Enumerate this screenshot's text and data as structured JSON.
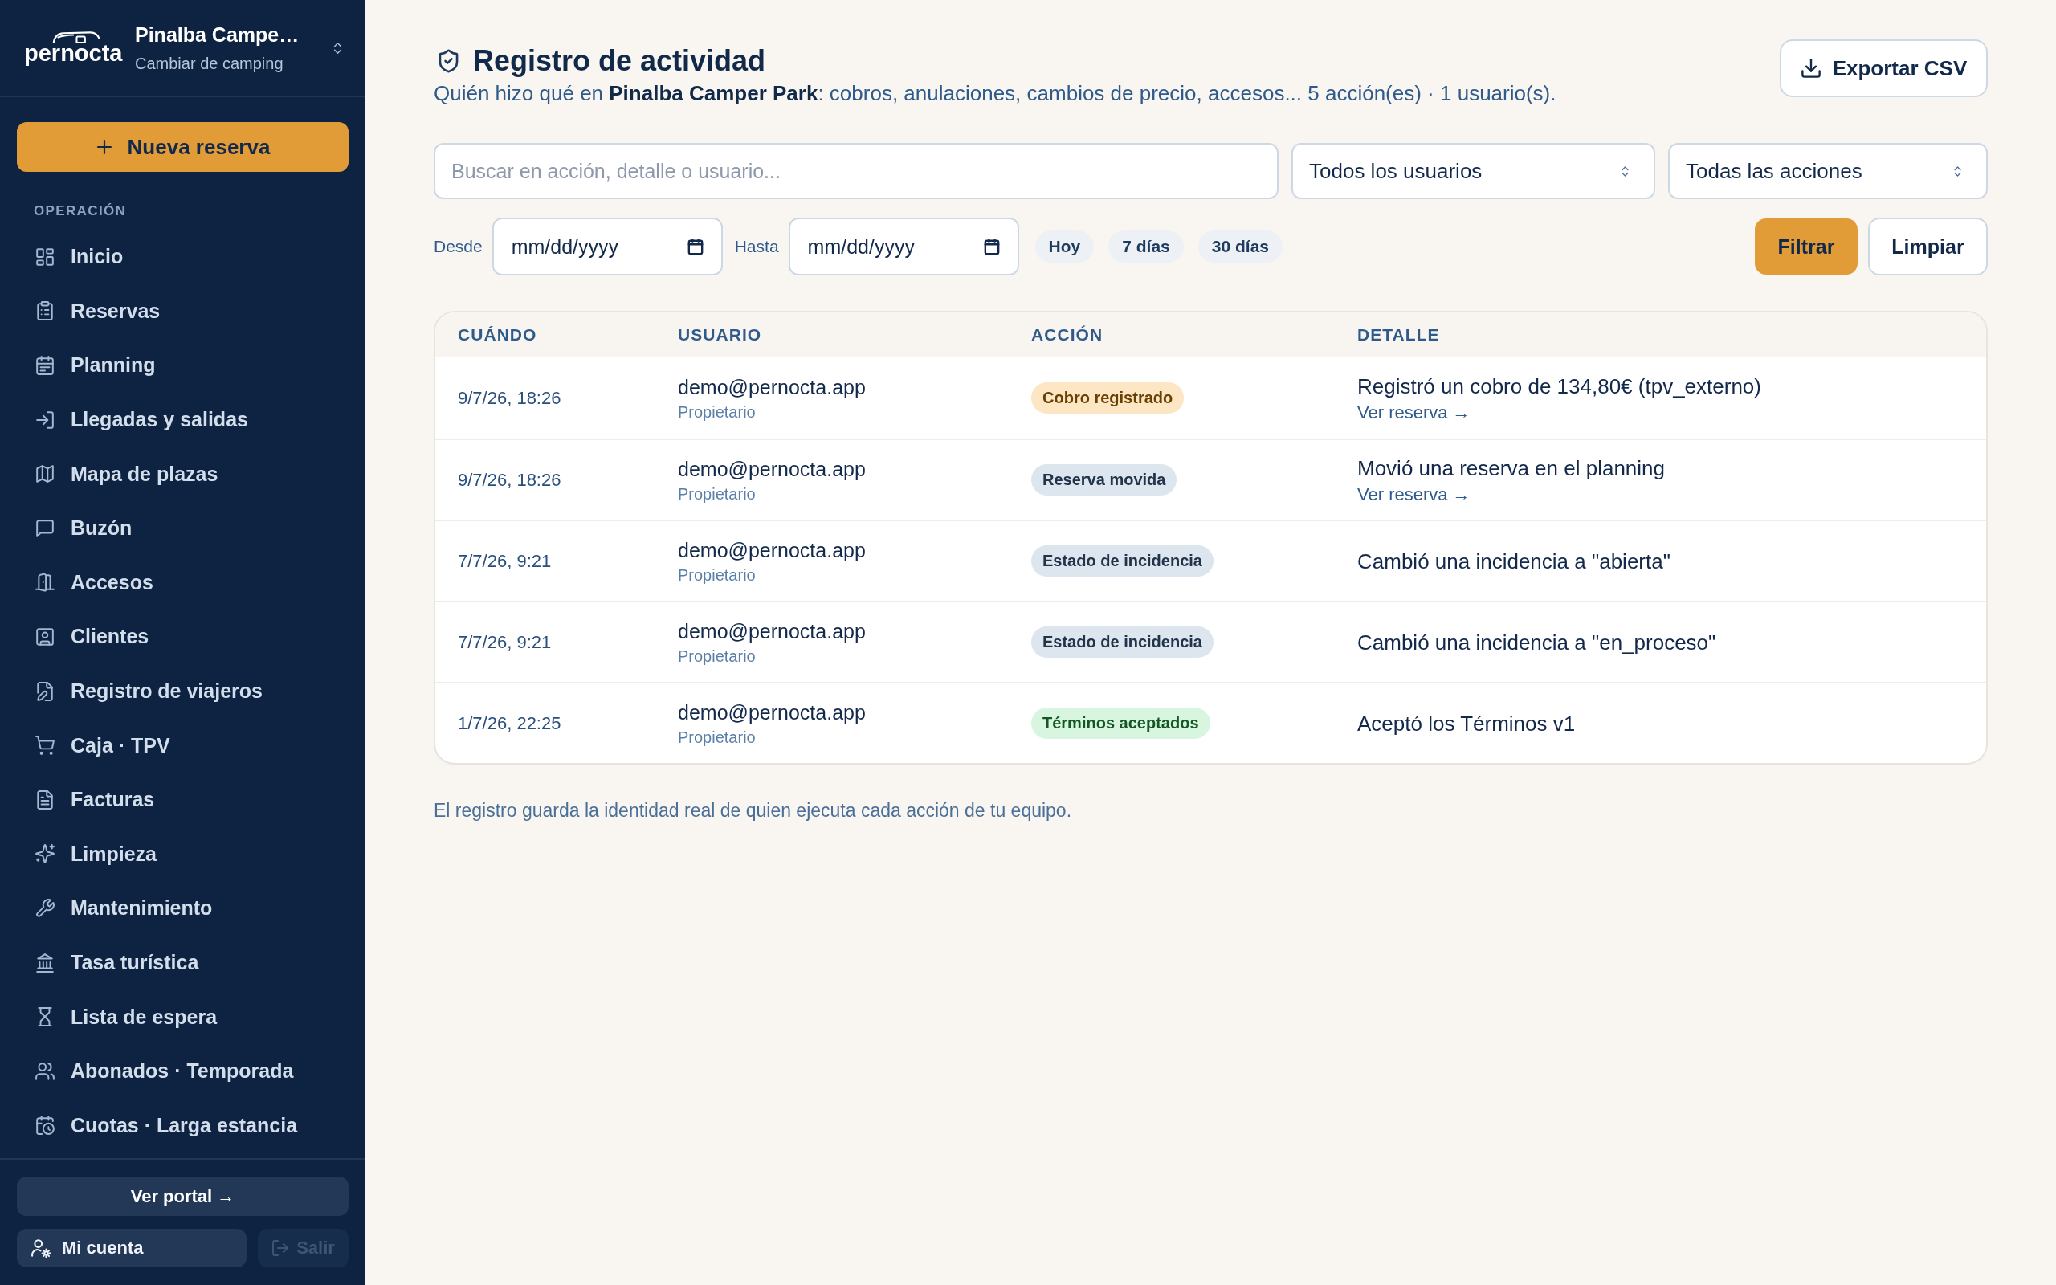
{
  "sidebar": {
    "logo": "pernocta",
    "campsite": {
      "name": "Pinalba Campe…",
      "switch_link": "Cambiar de camping"
    },
    "new_booking_button": "Nueva reserva",
    "section_label": "OPERACIÓN",
    "items": [
      {
        "label": "Inicio",
        "selected": false
      },
      {
        "label": "Reservas",
        "selected": false
      },
      {
        "label": "Planning",
        "selected": false
      },
      {
        "label": "Llegadas y salidas",
        "selected": false
      },
      {
        "label": "Mapa de plazas",
        "selected": false
      },
      {
        "label": "Buzón",
        "selected": false
      },
      {
        "label": "Accesos",
        "selected": false
      },
      {
        "label": "Clientes",
        "selected": false
      },
      {
        "label": "Registro de viajeros",
        "selected": false
      },
      {
        "label": "Caja · TPV",
        "selected": false
      },
      {
        "label": "Facturas",
        "selected": false
      },
      {
        "label": "Limpieza",
        "selected": false
      },
      {
        "label": "Mantenimiento",
        "selected": false
      },
      {
        "label": "Tasa turística",
        "selected": false
      },
      {
        "label": "Lista de espera",
        "selected": false
      },
      {
        "label": "Abonados · Temporada",
        "selected": false
      },
      {
        "label": "Cuotas · Larga estancia",
        "selected": false
      }
    ],
    "footer": {
      "portal_button": "Ver portal →",
      "account_button": "Mi cuenta",
      "logout_button": {
        "label": "Salir",
        "disabled": true
      }
    }
  },
  "header": {
    "title": "Registro de actividad",
    "subtitle": "Quién hizo qué en **Pinalba Camper Park**: cobros, anulaciones, cambios de precio, accesos... 5 acción(es) · 1 usuario(s).",
    "export_button": "Exportar CSV"
  },
  "filters": {
    "search": {
      "placeholder": "Buscar en acción, detalle o usuario..."
    },
    "user_select": {
      "value": "Todos los usuarios"
    },
    "action_select": {
      "value": "Todas las acciones"
    },
    "date_from": {
      "label": "Desde",
      "placeholder": "mm/dd/yyyy"
    },
    "date_to": {
      "label": "Hasta",
      "placeholder": "mm/dd/yyyy"
    },
    "presets": [
      "Hoy",
      "7 días",
      "30 días"
    ],
    "apply_button": "Filtrar",
    "clear_button": "Limpiar"
  },
  "table": {
    "columns": [
      "CUÁNDO",
      "USUARIO",
      "ACCIÓN",
      "DETALLE"
    ],
    "rows": [
      {
        "when": "9/7/26, 18:26",
        "user": {
          "email": "demo@pernocta.app",
          "role": "Propietario"
        },
        "action": {
          "label": "Cobro registrado",
          "color": "#fde6c3"
        },
        "detail": {
          "text": "Registró un cobro de 134,80€ (tpv_externo)",
          "link": "Ver reserva →"
        }
      },
      {
        "when": "9/7/26, 18:26",
        "user": {
          "email": "demo@pernocta.app",
          "role": "Propietario"
        },
        "action": {
          "label": "Reserva movida",
          "color": "#dde5ef"
        },
        "detail": {
          "text": "Movió una reserva en el planning",
          "link": "Ver reserva →"
        }
      },
      {
        "when": "7/7/26, 9:21",
        "user": {
          "email": "demo@pernocta.app",
          "role": "Propietario"
        },
        "action": {
          "label": "Estado de incidencia",
          "color": "#dde5ef"
        },
        "detail": {
          "text": "Cambió una incidencia a \"abierta\""
        }
      },
      {
        "when": "7/7/26, 9:21",
        "user": {
          "email": "demo@pernocta.app",
          "role": "Propietario"
        },
        "action": {
          "label": "Estado de incidencia",
          "color": "#dde5ef"
        },
        "detail": {
          "text": "Cambió una incidencia a \"en_proceso\""
        }
      },
      {
        "when": "1/7/26, 22:25",
        "user": {
          "email": "demo@pernocta.app",
          "role": "Propietario"
        },
        "action": {
          "label": "Términos aceptados",
          "color": "#d8f6df"
        },
        "detail": {
          "text": "Aceptó los Términos v1"
        }
      }
    ]
  },
  "footnote": "El registro guarda la identidad real de quien ejecuta cada acción de tu equipo."
}
